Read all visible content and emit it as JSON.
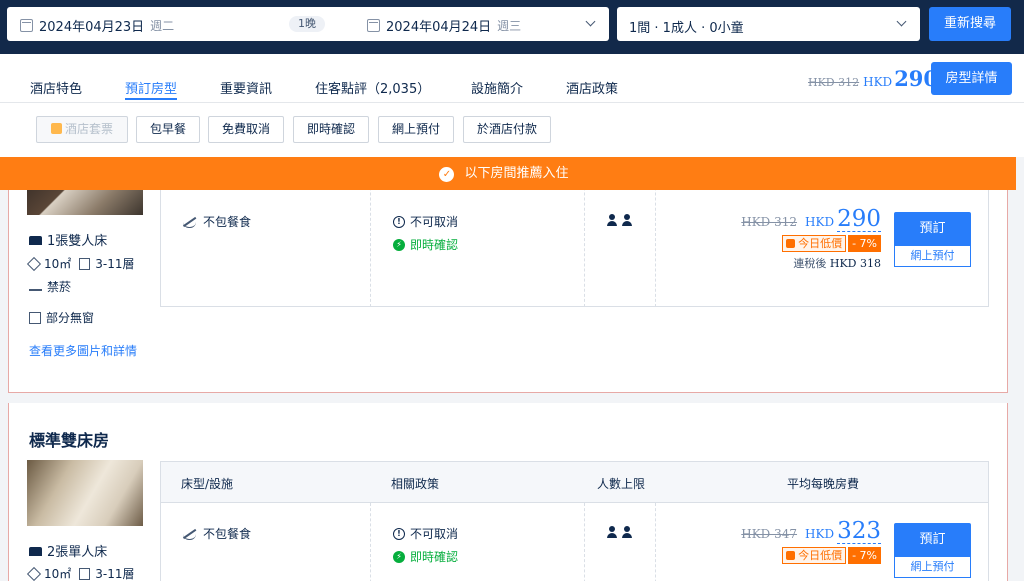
{
  "search": {
    "checkin_date": "2024年04月23日",
    "checkin_weekday": "週二",
    "nights": "1晚",
    "checkout_date": "2024年04月24日",
    "checkout_weekday": "週三",
    "guests": "1間 · 1成人 · 0小童",
    "search_button": "重新搜尋"
  },
  "tabs": [
    {
      "label": "酒店特色"
    },
    {
      "label": "預訂房型"
    },
    {
      "label": "重要資訊"
    },
    {
      "label": "住客點評（2,035）"
    },
    {
      "label": "設施簡介"
    },
    {
      "label": "酒店政策"
    }
  ],
  "active_tab": "預訂房型",
  "header_price": {
    "original": "HKD 312",
    "currency": "HKD",
    "amount": "290",
    "details_button": "房型詳情"
  },
  "filters": [
    {
      "label": "酒店套票",
      "disabled": true
    },
    {
      "label": "包早餐",
      "disabled": false
    },
    {
      "label": "免費取消",
      "disabled": false
    },
    {
      "label": "即時確認",
      "disabled": false
    },
    {
      "label": "網上預付",
      "disabled": false
    },
    {
      "label": "於酒店付款",
      "disabled": false
    }
  ],
  "banner": "以下房間推薦入住",
  "table_headers": {
    "bed_facilities": "床型/設施",
    "policy": "相關政策",
    "max_guests": "人數上限",
    "avg_price": "平均每晚房費"
  },
  "rooms": [
    {
      "name": "",
      "bed": "1張雙人床",
      "area": "10㎡",
      "floor": "3-11層",
      "smoking": "禁菸",
      "window": "部分無窗",
      "more_link": "查看更多圖片和詳情",
      "meal": "不包餐食",
      "cancel_policy": "不可取消",
      "confirm_policy": "即時確認",
      "max_guests": 2,
      "price_original": "HKD 312",
      "price_currency": "HKD",
      "price_amount": "290",
      "deal_label": "今日低價",
      "discount": "- 7%",
      "tax_label": "連稅後",
      "tax_price": "HKD 318",
      "book_button": "預訂",
      "pay_button": "網上預付"
    },
    {
      "name": "標準雙床房",
      "bed": "2張單人床",
      "area": "10㎡",
      "floor": "3-11層",
      "meal": "不包餐食",
      "cancel_policy": "不可取消",
      "confirm_policy": "即時確認",
      "max_guests": 2,
      "price_original": "HKD 347",
      "price_currency": "HKD",
      "price_amount": "323",
      "deal_label": "今日低價",
      "discount": "- 7%",
      "book_button": "預訂",
      "pay_button": "網上預付"
    }
  ],
  "colors": {
    "primary": "#287dfa",
    "banner": "#ff7d13",
    "instant": "#06ae3d",
    "header_bg": "#12294a"
  }
}
